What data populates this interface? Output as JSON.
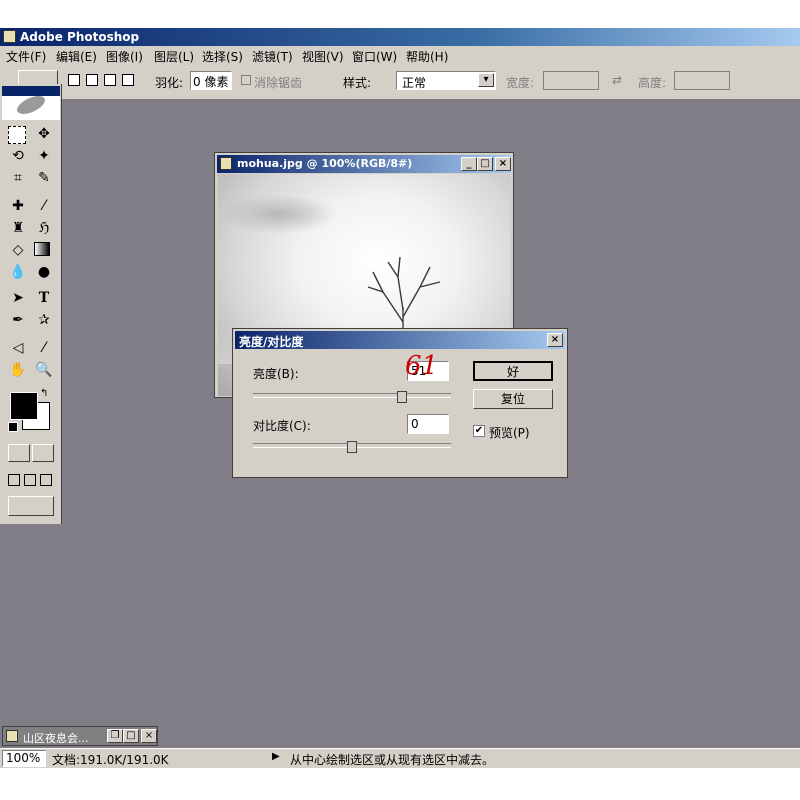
{
  "app": {
    "title": "Adobe Photoshop"
  },
  "menu": [
    "文件(F)",
    "编辑(E)",
    "图像(I)",
    "图层(L)",
    "选择(S)",
    "滤镜(T)",
    "视图(V)",
    "窗口(W)",
    "帮助(H)"
  ],
  "options": {
    "feather_label": "羽化:",
    "feather_value": "0 像素",
    "antialias_label": "消除锯齿",
    "style_label": "样式:",
    "style_value": "正常",
    "width_label": "宽度:",
    "height_label": "高度:"
  },
  "document": {
    "title": "mohua.jpg @ 100%(RGB/8#)"
  },
  "dialog": {
    "title": "亮度/对比度",
    "brightness_label": "亮度(B):",
    "brightness_value": "51",
    "brightness_level": 0.75,
    "annotation": "61",
    "contrast_label": "对比度(C):",
    "contrast_value": "0",
    "contrast_level": 0.5,
    "ok_label": "好",
    "reset_label": "复位",
    "preview_label": "预览(P)",
    "preview_checked": true
  },
  "minimized_doc": {
    "title": "山区夜息会..."
  },
  "status": {
    "zoom": "100%",
    "doc_info": "文档:191.0K/191.0K",
    "hint": "从中心绘制选区或从现有选区中减去。"
  },
  "colors": {
    "workspace": "#817d86",
    "chrome": "#d4d0c8",
    "annotation": "#cc0000",
    "titlebar": "#0a246a"
  }
}
